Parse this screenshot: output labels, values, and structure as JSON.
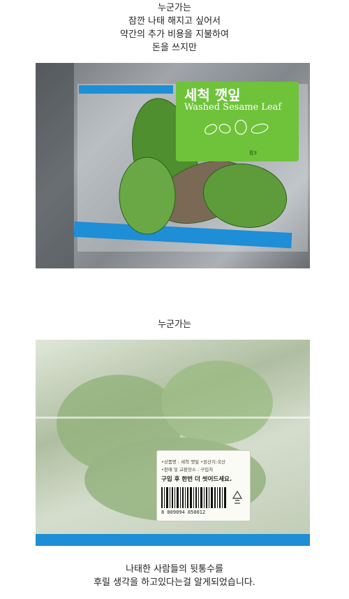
{
  "captions": {
    "top": [
      "누군가는",
      "잠깐 나태 해지고 싶어서",
      "약간의 추가 비용을 지불하여",
      "돈을 쓰지만"
    ],
    "middle": "누군가는",
    "bottom": [
      "나태한 사람들의 뒷통수를",
      "후릴 생각을 하고있다는걸 알게되었습니다."
    ]
  },
  "photo1": {
    "package_title_ko": "세척 깻잎",
    "package_title_en": "Washed Sesame Leaf",
    "brand_mark": "팜3",
    "colors": {
      "label_green": "#6fc33a",
      "tape_blue": "#1e8ed6"
    }
  },
  "photo2": {
    "sticker": {
      "line1": "•상품명 : 세척 깻잎   •원산지:국산",
      "line2": "•판매 및 교환장소 : 구입처",
      "notice": "구입 후 한번 더 씻어드세요.",
      "barcode_number": "8  809094   050012"
    },
    "colors": {
      "tape_blue": "#1e8ed6"
    }
  }
}
